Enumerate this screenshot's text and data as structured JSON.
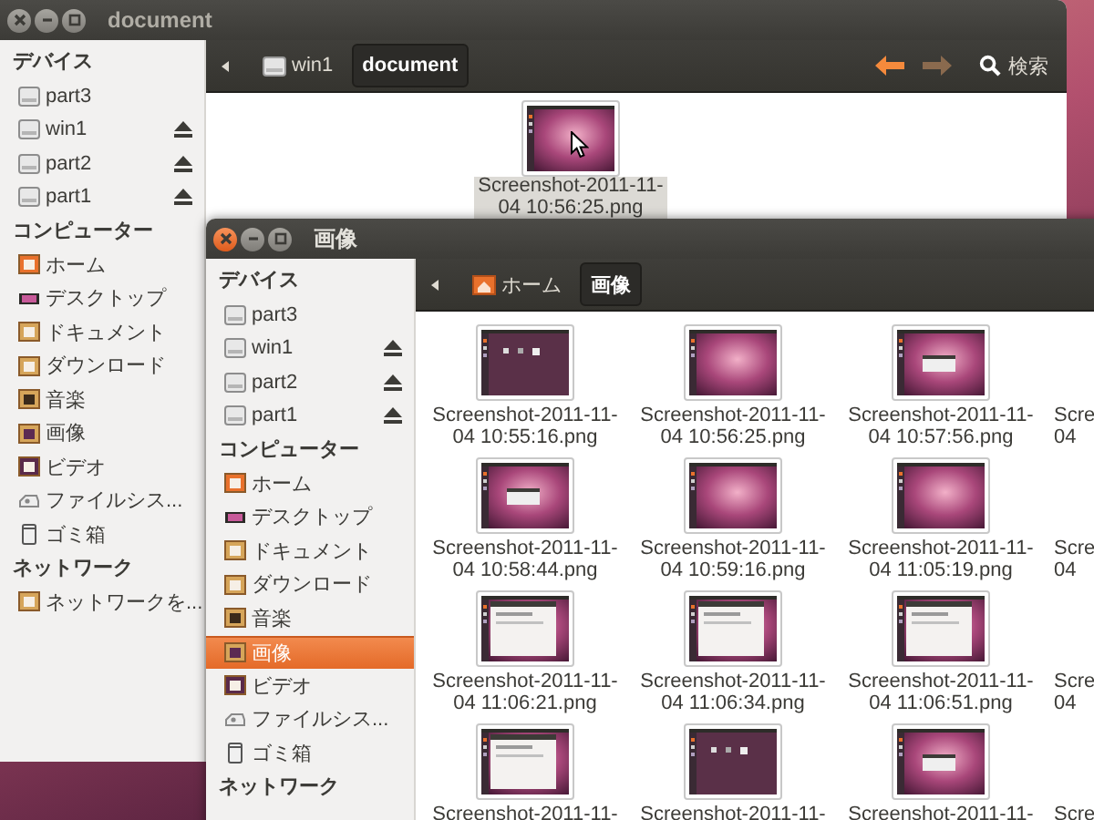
{
  "windows": [
    {
      "title": "document",
      "focused": false,
      "sidebar": [
        {
          "heading": "デバイス",
          "items": [
            {
              "label": "part3",
              "ejectable": false,
              "selected": false
            },
            {
              "label": "win1",
              "ejectable": true,
              "selected": false
            },
            {
              "label": "part2",
              "ejectable": true,
              "selected": false
            },
            {
              "label": "part1",
              "ejectable": true,
              "selected": false
            }
          ]
        },
        {
          "heading": "コンピューター",
          "items": [
            {
              "label": "ホーム",
              "ejectable": false,
              "selected": false
            },
            {
              "label": "デスクトップ",
              "ejectable": false,
              "selected": false
            },
            {
              "label": "ドキュメント",
              "ejectable": false,
              "selected": false
            },
            {
              "label": "ダウンロード",
              "ejectable": false,
              "selected": false
            },
            {
              "label": "音楽",
              "ejectable": false,
              "selected": false
            },
            {
              "label": "画像",
              "ejectable": false,
              "selected": false
            },
            {
              "label": "ビデオ",
              "ejectable": false,
              "selected": false
            },
            {
              "label": "ファイルシス...",
              "ejectable": false,
              "selected": false
            },
            {
              "label": "ゴミ箱",
              "ejectable": false,
              "selected": false
            }
          ]
        },
        {
          "heading": "ネットワーク",
          "items": [
            {
              "label": "ネットワークを...",
              "ejectable": false,
              "selected": false
            }
          ]
        }
      ],
      "path": [
        {
          "label": "win1",
          "selected": false
        },
        {
          "label": "document",
          "selected": true
        }
      ],
      "back_enabled": true,
      "forward_enabled": false,
      "search_label": "検索",
      "files": [
        {
          "lines": [
            "Screenshot-2011-11-",
            "04 10:56:25.png"
          ],
          "selected": true,
          "clipped": false
        }
      ]
    },
    {
      "title": "画像",
      "focused": true,
      "sidebar": [
        {
          "heading": "デバイス",
          "items": [
            {
              "label": "part3",
              "ejectable": false,
              "selected": false
            },
            {
              "label": "win1",
              "ejectable": true,
              "selected": false
            },
            {
              "label": "part2",
              "ejectable": true,
              "selected": false
            },
            {
              "label": "part1",
              "ejectable": true,
              "selected": false
            }
          ]
        },
        {
          "heading": "コンピューター",
          "items": [
            {
              "label": "ホーム",
              "ejectable": false,
              "selected": false
            },
            {
              "label": "デスクトップ",
              "ejectable": false,
              "selected": false
            },
            {
              "label": "ドキュメント",
              "ejectable": false,
              "selected": false
            },
            {
              "label": "ダウンロード",
              "ejectable": false,
              "selected": false
            },
            {
              "label": "音楽",
              "ejectable": false,
              "selected": false
            },
            {
              "label": "画像",
              "ejectable": false,
              "selected": true
            },
            {
              "label": "ビデオ",
              "ejectable": false,
              "selected": false
            },
            {
              "label": "ファイルシス...",
              "ejectable": false,
              "selected": false
            },
            {
              "label": "ゴミ箱",
              "ejectable": false,
              "selected": false
            }
          ]
        },
        {
          "heading": "ネットワーク"
        }
      ],
      "path": [
        {
          "label": "ホーム",
          "selected": false
        },
        {
          "label": "画像",
          "selected": true
        }
      ],
      "files": [
        {
          "lines": [
            "Screenshot-2011-11-",
            "04 10:55:16.png"
          ],
          "selected": false,
          "clipped": false
        },
        {
          "lines": [
            "Screenshot-2011-11-",
            "04 10:56:25.png"
          ],
          "selected": false,
          "clipped": false
        },
        {
          "lines": [
            "Screenshot-2011-11-",
            "04 10:57:56.png"
          ],
          "selected": false,
          "clipped": false
        },
        {
          "lines": [
            "Scre",
            "04"
          ],
          "selected": false,
          "clipped": true
        },
        {
          "lines": [
            "Screenshot-2011-11-",
            "04 10:58:44.png"
          ],
          "selected": false,
          "clipped": false
        },
        {
          "lines": [
            "Screenshot-2011-11-",
            "04 10:59:16.png"
          ],
          "selected": false,
          "clipped": false
        },
        {
          "lines": [
            "Screenshot-2011-11-",
            "04 11:05:19.png"
          ],
          "selected": false,
          "clipped": false
        },
        {
          "lines": [
            "Scre",
            "04"
          ],
          "selected": false,
          "clipped": true
        },
        {
          "lines": [
            "Screenshot-2011-11-",
            "04 11:06:21.png"
          ],
          "selected": false,
          "clipped": false
        },
        {
          "lines": [
            "Screenshot-2011-11-",
            "04 11:06:34.png"
          ],
          "selected": false,
          "clipped": false
        },
        {
          "lines": [
            "Screenshot-2011-11-",
            "04 11:06:51.png"
          ],
          "selected": false,
          "clipped": false
        },
        {
          "lines": [
            "Scre",
            "04"
          ],
          "selected": false,
          "clipped": true
        },
        {
          "lines": [
            "Screenshot-2011-11-"
          ],
          "selected": false,
          "clipped": false
        },
        {
          "lines": [
            "Screenshot-2011-11-"
          ],
          "selected": false,
          "clipped": false
        },
        {
          "lines": [
            "Screenshot-2011-11-"
          ],
          "selected": false,
          "clipped": false
        },
        {
          "lines": [
            "Scre"
          ],
          "selected": false,
          "clipped": true
        }
      ]
    }
  ]
}
